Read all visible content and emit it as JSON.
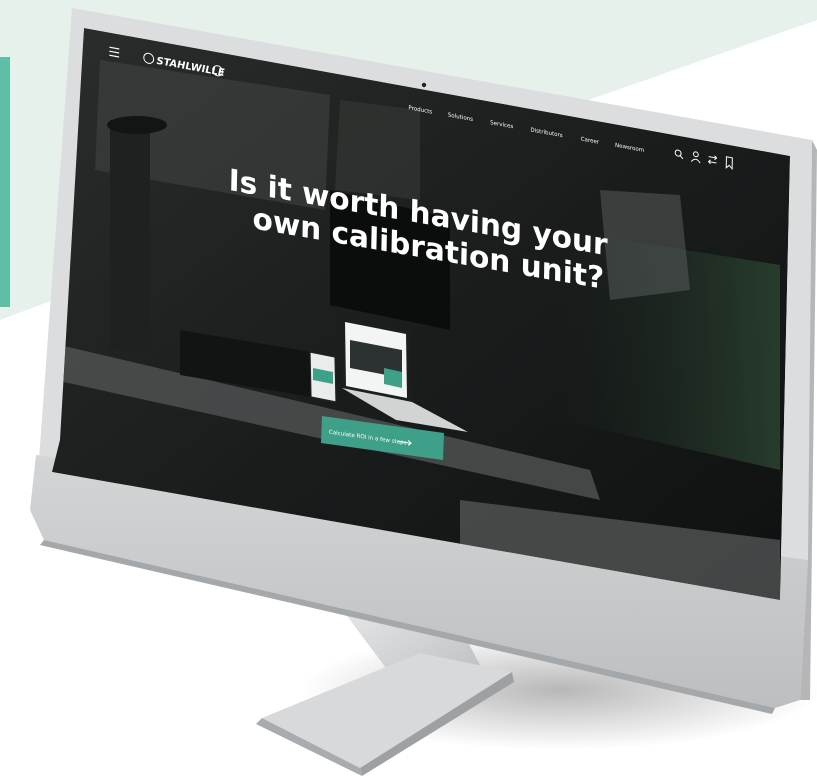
{
  "brand": {
    "logo_text": "STAHLWILLE"
  },
  "nav": {
    "items": [
      "Products",
      "Solutions",
      "Services",
      "Distributors",
      "Career",
      "Newsroom"
    ]
  },
  "hero": {
    "headline_line1": "Is it worth having your",
    "headline_line2": "own calibration unit?",
    "cta_label": "Calculate ROI in a few steps"
  },
  "colors": {
    "accent": "#3fa08a",
    "background_wedge": "#e6f1ec",
    "teal_bar": "#5fbfa6",
    "screen_dark": "#1d2221",
    "bezel": "#d9dadb"
  },
  "icons": [
    "menu-icon",
    "search-icon",
    "user-icon",
    "compare-icon",
    "bookmark-icon",
    "arrow-right-icon"
  ]
}
